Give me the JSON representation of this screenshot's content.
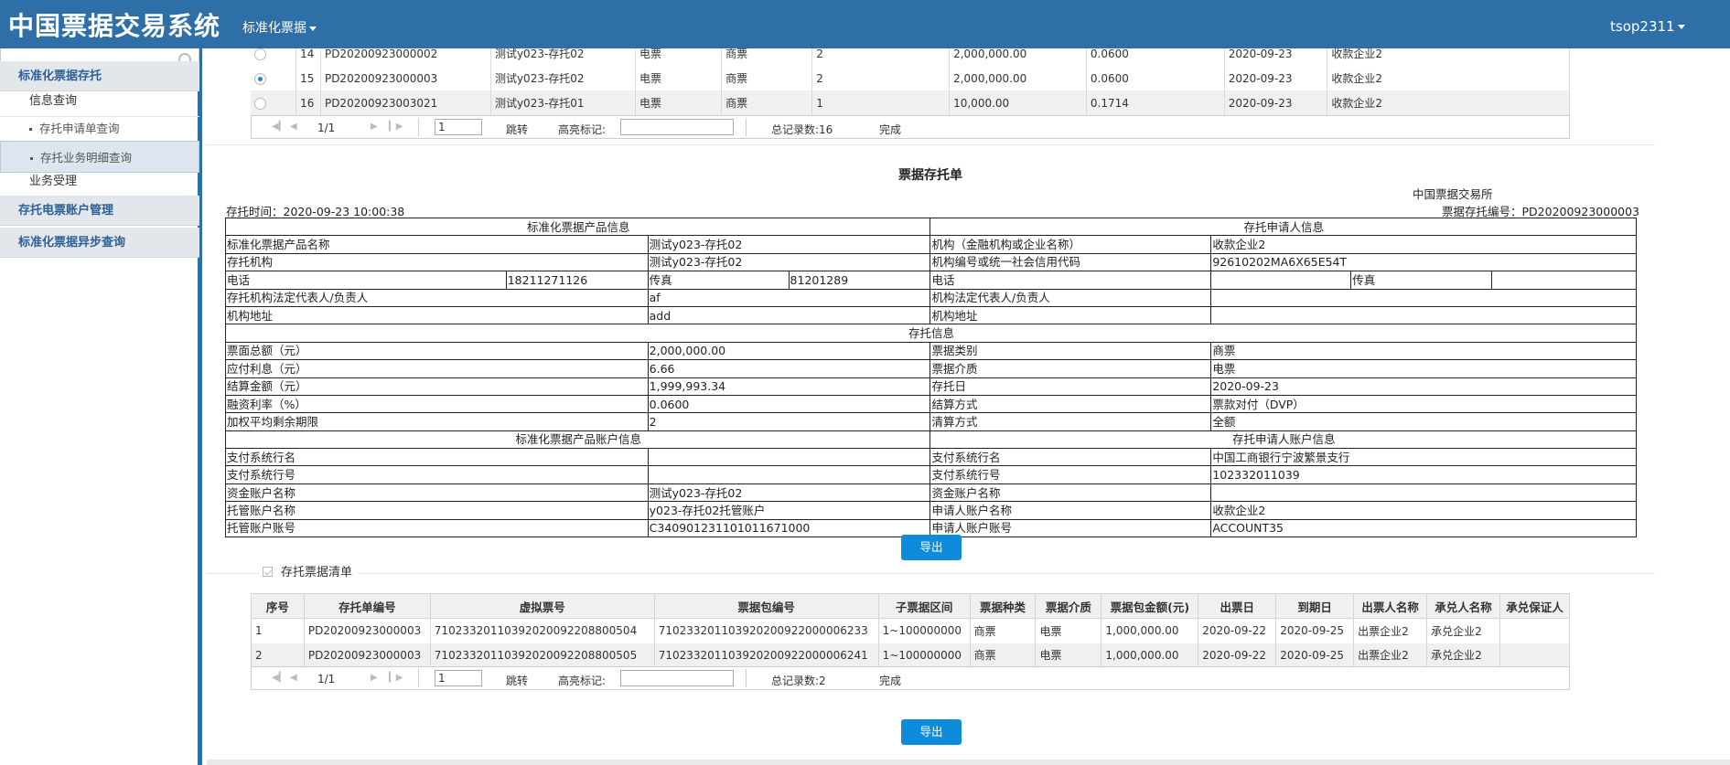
{
  "header": {
    "brand": "中国票据交易系统",
    "menu_label": "标准化票据",
    "user": "tsop2311"
  },
  "sidebar": {
    "search_placeholder": "",
    "items": [
      {
        "label": "标准化票据存托"
      },
      {
        "label": "信息查询"
      },
      {
        "label": "存托申请单查询"
      },
      {
        "label": "存托业务明细查询"
      },
      {
        "label": "业务受理"
      },
      {
        "label": "存托电票账户管理"
      },
      {
        "label": "标准化票据异步查询"
      }
    ]
  },
  "top_table": {
    "rows": [
      {
        "no": "14",
        "app_no": "PD20200923000002",
        "product": "测试y023-存托02",
        "medium": "电票",
        "type": "商票",
        "count": "2",
        "amount": "2,000,000.00",
        "rate": "0.0600",
        "date": "2020-09-23",
        "payee": "收款企业2"
      },
      {
        "no": "15",
        "app_no": "PD20200923000003",
        "product": "测试y023-存托02",
        "medium": "电票",
        "type": "商票",
        "count": "2",
        "amount": "2,000,000.00",
        "rate": "0.0600",
        "date": "2020-09-23",
        "payee": "收款企业2"
      },
      {
        "no": "16",
        "app_no": "PD20200923003021",
        "product": "测试y023-存托01",
        "medium": "电票",
        "type": "商票",
        "count": "1",
        "amount": "10,000.00",
        "rate": "0.1714",
        "date": "2020-09-23",
        "payee": "收款企业2"
      }
    ],
    "selected_row": "15"
  },
  "pager1": {
    "page_info": "1/1",
    "page_input": "1",
    "jump_label": "跳转",
    "mark_label": "高亮标记:",
    "total": "总记录数:16",
    "done": "完成"
  },
  "doc": {
    "title": "票据存托单",
    "org": "中国票据交易所",
    "time": "存托时间：2020-09-23 10:00:38",
    "doc_no": "票据存托编号：PD20200923000003",
    "sec_product": "标准化票据产品信息",
    "sec_applicant": "存托申请人信息",
    "sec_info": "存托信息",
    "sec_product_acct": "标准化票据产品账户信息",
    "sec_applicant_acct": "存托申请人账户信息",
    "product_name_label": "标准化票据产品名称",
    "product_name": "测试y023-存托02",
    "org_label": "机构（金融机构或企业名称）",
    "org_value": "收款企业2",
    "custodian_label": "存托机构",
    "custodian_value": "测试y023-存托02",
    "org_code_label": "机构编号或统一社会信用代码",
    "org_code": "92610202MA6X65E54T",
    "phone_label": "电话",
    "phone": "18211271126",
    "fax_label": "传真",
    "fax": "81201289",
    "applicant_phone_label": "电话",
    "applicant_fax_label": "传真",
    "legal_label": "存托机构法定代表人/负责人",
    "legal_value": "af",
    "org_legal_label": "机构法定代表人/负责人",
    "address_label": "机构地址",
    "address_value": "add",
    "applicant_address_label": "机构地址",
    "face_total_label": "票面总额（元）",
    "face_total": "2,000,000.00",
    "bill_type_label": "票据类别",
    "bill_type": "商票",
    "interest_label": "应付利息（元）",
    "interest": "6.66",
    "medium_label": "票据介质",
    "medium": "电票",
    "settle_amount_label": "结算金额（元）",
    "settle_amount": "1,999,993.34",
    "custody_date_label": "存托日",
    "custody_date": "2020-09-23",
    "rate_label": "融资利率（%）",
    "rate": "0.0600",
    "settle_method_label": "结算方式",
    "settle_method": "票款对付（DVP）",
    "term_label": "加权平均剩余期限",
    "term": "2",
    "clear_method_label": "清算方式",
    "clear_method": "全额",
    "pay_bank_name_label": "支付系统行名",
    "pay_bank_no_label": "支付系统行号",
    "applicant_bank_name_label": "支付系统行名",
    "applicant_bank_name": "中国工商银行宁波繁景支行",
    "applicant_bank_no_label": "支付系统行号",
    "applicant_bank_no": "102332011039",
    "fund_acct_name_label": "资金账户名称",
    "fund_acct_name": "测试y023-存托02",
    "applicant_fund_acct_label": "资金账户名称",
    "custody_acct_name_label": "托管账户名称",
    "custody_acct_name": "y023-存托02托管账户",
    "applicant_acct_name_label": "申请人账户名称",
    "applicant_acct_name": "收款企业2",
    "custody_acct_no_label": "托管账户账号",
    "custody_acct_no": "C340901231101011671000",
    "applicant_acct_no_label": "申请人账户账号",
    "applicant_acct_no": "ACCOUNT35",
    "export_label": "导出"
  },
  "bill_list": {
    "legend": "存托票据清单",
    "headers": [
      "序号",
      "存托单编号",
      "虚拟票号",
      "票据包编号",
      "子票据区间",
      "票据种类",
      "票据介质",
      "票据包金额(元)",
      "出票日",
      "到期日",
      "出票人名称",
      "承兑人名称",
      "承兑保证人"
    ],
    "rows": [
      [
        "1",
        "PD20200923000003",
        "71023320110392020092208800504",
        "710233201103920200922000006233",
        "1~100000000",
        "商票",
        "电票",
        "1,000,000.00",
        "2020-09-22",
        "2020-09-25",
        "出票企业2",
        "承兑企业2",
        ""
      ],
      [
        "2",
        "PD20200923000003",
        "71023320110392020092208800505",
        "710233201103920200922000006241",
        "1~100000000",
        "商票",
        "电票",
        "1,000,000.00",
        "2020-09-22",
        "2020-09-25",
        "出票企业2",
        "承兑企业2",
        ""
      ]
    ]
  },
  "pager2": {
    "page_info": "1/1",
    "page_input": "1",
    "jump_label": "跳转",
    "mark_label": "高亮标记:",
    "total": "总记录数:2",
    "done": "完成"
  },
  "export2_label": "导出",
  "colors": {
    "header_bg": "#2f6fa8",
    "accent": "#0e8cdb",
    "menu_text": "#2c5f95"
  },
  "icons": [
    "search-icon",
    "caret-down-icon",
    "first-page-icon",
    "prev-page-icon",
    "next-page-icon",
    "last-page-icon",
    "checkbox-icon"
  ]
}
